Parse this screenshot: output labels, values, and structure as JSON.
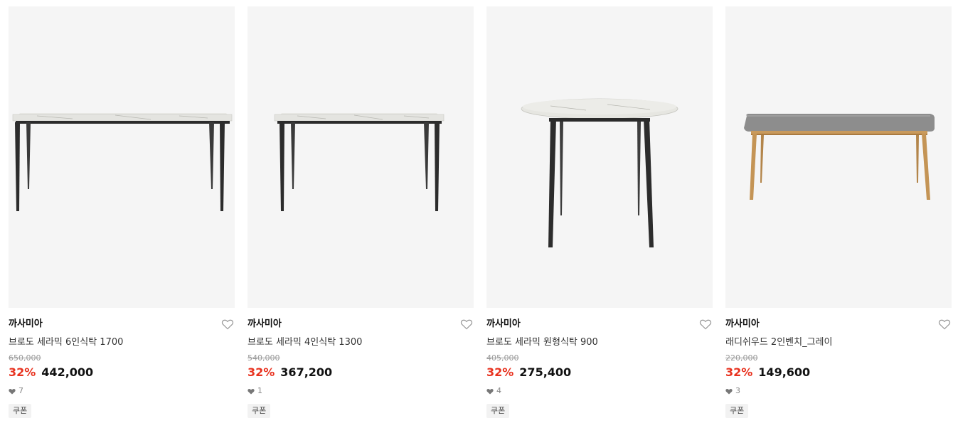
{
  "products": [
    {
      "brand": "까사미아",
      "name": "브로도 세라믹 6인식탁 1700",
      "original_price": "650,000",
      "discount_rate": "32%",
      "price": "442,000",
      "likes": "7",
      "badge": "쿠폰",
      "image_icon": "rectangular-dining-table-image"
    },
    {
      "brand": "까사미아",
      "name": "브로도 세라믹 4인식탁 1300",
      "original_price": "540,000",
      "discount_rate": "32%",
      "price": "367,200",
      "likes": "1",
      "badge": "쿠폰",
      "image_icon": "rectangular-dining-table-image"
    },
    {
      "brand": "까사미아",
      "name": "브로도 세라믹 원형식탁 900",
      "original_price": "405,000",
      "discount_rate": "32%",
      "price": "275,400",
      "likes": "4",
      "badge": "쿠폰",
      "image_icon": "round-dining-table-image"
    },
    {
      "brand": "까사미아",
      "name": "래디쉬우드 2인벤치_그레이",
      "original_price": "220,000",
      "discount_rate": "32%",
      "price": "149,600",
      "likes": "3",
      "badge": "쿠폰",
      "image_icon": "wooden-bench-image"
    }
  ],
  "colors": {
    "discount": "#e8321f",
    "thumb_bg": "#f5f5f5",
    "heart_outline": "#999999",
    "like_heart": "#777777"
  }
}
